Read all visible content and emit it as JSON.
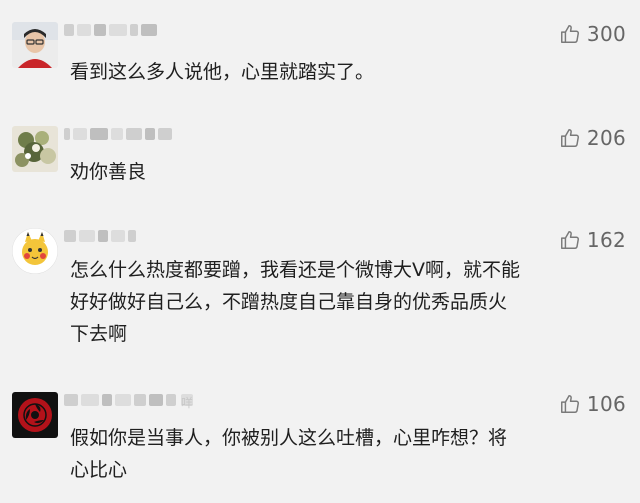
{
  "comments": [
    {
      "name_tail": "",
      "likes": "300",
      "text": "看到这么多人说他，心里就踏实了。"
    },
    {
      "name_tail": "",
      "likes": "206",
      "text": "劝你善良"
    },
    {
      "name_tail": "",
      "likes": "162",
      "text": "怎么什么热度都要蹭，我看还是个微博大V啊，就不能\n好好做好自己么，不蹭热度自己靠自身的优秀品质火\n下去啊"
    },
    {
      "name_tail": "咩",
      "likes": "106",
      "text": "假如你是当事人，你被别人这么吐槽，心里咋想？将\n心比心"
    }
  ],
  "icons": {
    "like": "thumbs-up-icon"
  },
  "colors": {
    "background": "#f2f2f2",
    "text": "#1f1f1f",
    "like": "#7a7a7a"
  }
}
